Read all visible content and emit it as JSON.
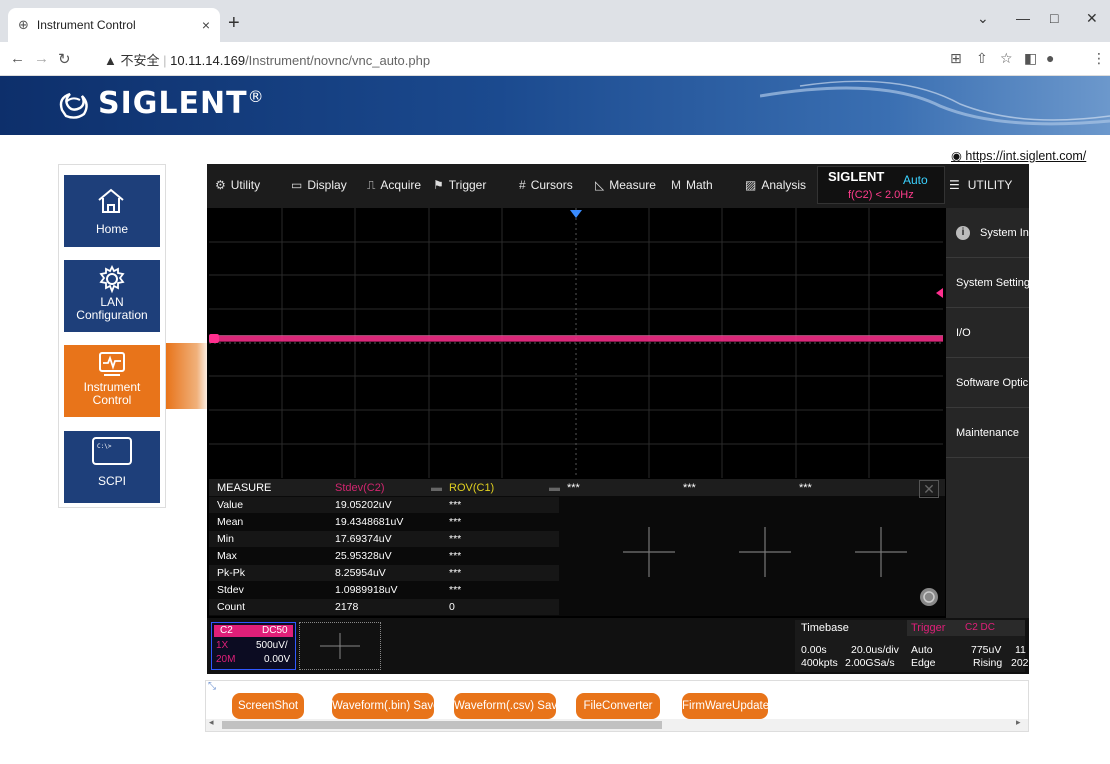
{
  "browser": {
    "tab_title": "Instrument Control",
    "tab_close": "×",
    "new_tab": "+",
    "url_warning": "▲ 不安全",
    "url_host": "10.11.14.169",
    "url_path": "/Instrument/novnc/vnc_auto.php",
    "win_min": "—",
    "win_max": "□",
    "win_close": "✕",
    "win_chevron": "⌄"
  },
  "header": {
    "brand": "SIGLENT",
    "reg": "®",
    "link": "https://int.siglent.com/"
  },
  "leftnav": {
    "items": [
      {
        "label": "Home"
      },
      {
        "label": "LAN Configuration"
      },
      {
        "label": "Instrument Control"
      },
      {
        "label": "SCPI"
      }
    ]
  },
  "scope": {
    "menu": [
      "Utility",
      "Display",
      "Acquire",
      "Trigger",
      "Cursors",
      "Measure",
      "Math",
      "Analysis"
    ],
    "brand": "SIGLENT",
    "auto": "Auto",
    "freq": "f(C2) < 2.0Hz",
    "util_header": "UTILITY",
    "right_menu": [
      "System In",
      "System Setting",
      "I/O",
      "Software Optic",
      "Maintenance"
    ],
    "trace_color": "#ff2f8e",
    "measure": {
      "header": "MEASURE",
      "col1_title": "Stdev(C2)",
      "col2_title": "ROV(C1)",
      "col3_title": "***",
      "col4_title": "***",
      "col5_title": "***",
      "rows": [
        {
          "name": "Value",
          "v1": "19.05202uV",
          "v2": "***"
        },
        {
          "name": "Mean",
          "v1": "19.4348681uV",
          "v2": "***"
        },
        {
          "name": "Min",
          "v1": "17.69374uV",
          "v2": "***"
        },
        {
          "name": "Max",
          "v1": "25.95328uV",
          "v2": "***"
        },
        {
          "name": "Pk-Pk",
          "v1": "8.25954uV",
          "v2": "***"
        },
        {
          "name": "Stdev",
          "v1": "1.0989918uV",
          "v2": "***"
        },
        {
          "name": "Count",
          "v1": "2178",
          "v2": "0"
        }
      ]
    },
    "channel": {
      "name": "C2",
      "coupling": "DC50",
      "probe": "1X",
      "scale": "500uV/",
      "bw": "20M",
      "offset": "0.00V"
    },
    "timebase": {
      "title": "Timebase",
      "delay": "0.00s",
      "tdiv": "20.0us/div",
      "points": "400kpts",
      "rate": "2.00GSa/s"
    },
    "trigger": {
      "title": "Trigger",
      "src": "C2 DC",
      "mode": "Auto",
      "level": "775uV",
      "type": "Edge",
      "slope": "Rising",
      "extra1": "11",
      "extra2": "202"
    }
  },
  "buttons": [
    "ScreenShot",
    "Waveform(.bin) Save",
    "Waveform(.csv) Save",
    "FileConverter",
    "FirmWareUpdate"
  ]
}
